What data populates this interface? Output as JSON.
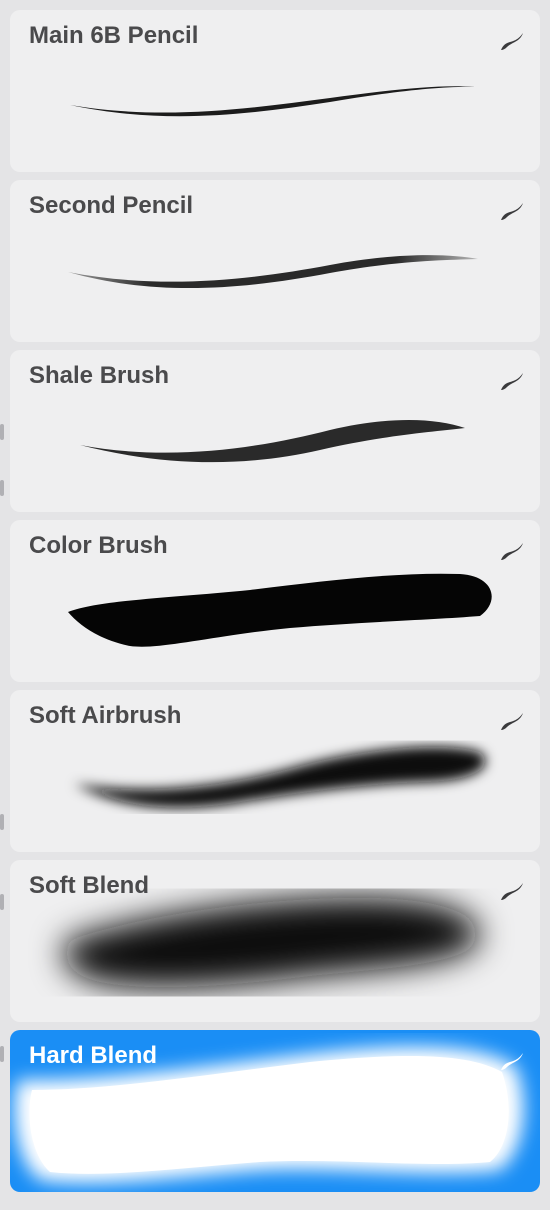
{
  "brushes": [
    {
      "name": "Main 6B Pencil",
      "icon": "brush-stroke-icon",
      "selected": false
    },
    {
      "name": "Second Pencil",
      "icon": "brush-stroke-icon",
      "selected": false
    },
    {
      "name": "Shale Brush",
      "icon": "brush-stroke-icon",
      "selected": false
    },
    {
      "name": "Color Brush",
      "icon": "brush-stroke-icon",
      "selected": false
    },
    {
      "name": "Soft Airbrush",
      "icon": "brush-stroke-icon",
      "selected": false
    },
    {
      "name": "Soft Blend",
      "icon": "brush-stroke-icon",
      "selected": false
    },
    {
      "name": "Hard Blend",
      "icon": "brush-stroke-icon",
      "selected": true
    }
  ],
  "colors": {
    "card_background": "#efeff0",
    "selected_background": "#1a8ef5",
    "label_text": "#4a4a4c",
    "selected_label_text": "#ffffff"
  }
}
